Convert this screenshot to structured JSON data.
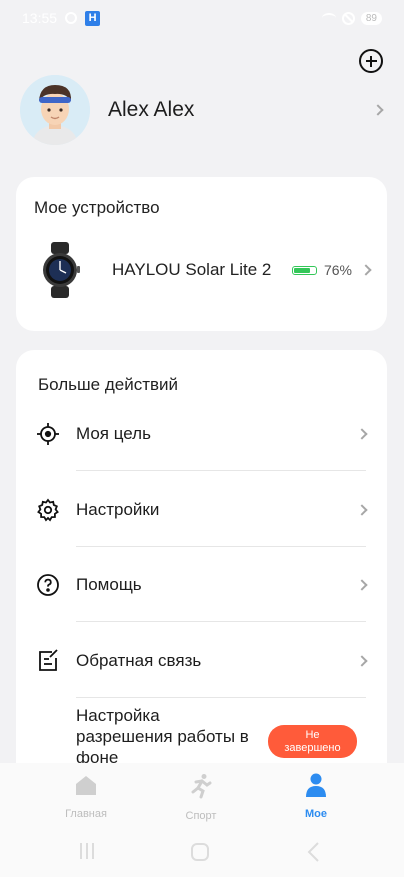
{
  "status_bar": {
    "time": "13:55",
    "battery": "89"
  },
  "profile": {
    "name": "Alex Alex"
  },
  "device_card": {
    "title": "Мое устройство",
    "device_name": "HAYLOU Solar Lite 2",
    "battery_fraction": 0.76,
    "battery_label": "76%"
  },
  "actions_card": {
    "title": "Больше действий",
    "items": [
      {
        "label": "Моя цель",
        "icon": "target-icon"
      },
      {
        "label": "Настройки",
        "icon": "gear-icon"
      },
      {
        "label": "Помощь",
        "icon": "question-icon"
      },
      {
        "label": "Обратная связь",
        "icon": "feedback-icon"
      }
    ],
    "permission_label": "Настройка разрешения работы в фоне",
    "permission_status": "Не завершено"
  },
  "bottom_nav": [
    {
      "label": "Главная",
      "icon": "home-icon",
      "active": false
    },
    {
      "label": "Спорт",
      "icon": "running-icon",
      "active": false
    },
    {
      "label": "Мое",
      "icon": "person-icon",
      "active": true
    }
  ],
  "colors": {
    "accent": "#2d8cf0",
    "battery": "#34c759",
    "warning": "#ff5b3a"
  }
}
